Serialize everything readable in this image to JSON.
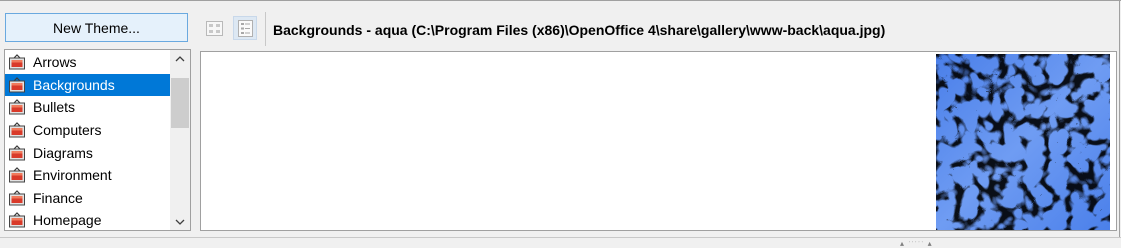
{
  "toolbar": {
    "new_theme_label": "New Theme...",
    "icon_view_icon": "icon-grid-view-icon",
    "detail_view_icon": "detail-list-view-icon",
    "path_title": "Backgrounds - aqua (C:\\Program Files (x86)\\OpenOffice 4\\share\\gallery\\www-back\\aqua.jpg)"
  },
  "themes": {
    "items": [
      {
        "label": "Arrows",
        "icon": "gallery-theme-icon",
        "selected": false
      },
      {
        "label": "Backgrounds",
        "icon": "gallery-theme-icon",
        "selected": true
      },
      {
        "label": "Bullets",
        "icon": "gallery-theme-icon",
        "selected": false
      },
      {
        "label": "Computers",
        "icon": "gallery-theme-icon",
        "selected": false
      },
      {
        "label": "Diagrams",
        "icon": "gallery-theme-icon",
        "selected": false
      },
      {
        "label": "Environment",
        "icon": "gallery-theme-icon",
        "selected": false
      },
      {
        "label": "Finance",
        "icon": "gallery-theme-icon",
        "selected": false
      },
      {
        "label": "Homepage",
        "icon": "gallery-theme-icon",
        "selected": false
      }
    ],
    "scroll_up_icon": "chevron-up-icon",
    "scroll_down_icon": "chevron-down-icon"
  },
  "preview": {
    "item_image": "aqua-water-texture"
  },
  "colors": {
    "selection": "#0078d7",
    "button_hover_bg": "#e5f1fb",
    "button_hover_border": "#6aa9df",
    "water_light": "#d6e6fb",
    "water_mid": "#5c8ef2"
  },
  "status": {
    "grip_icon": "resize-grip-icon"
  }
}
